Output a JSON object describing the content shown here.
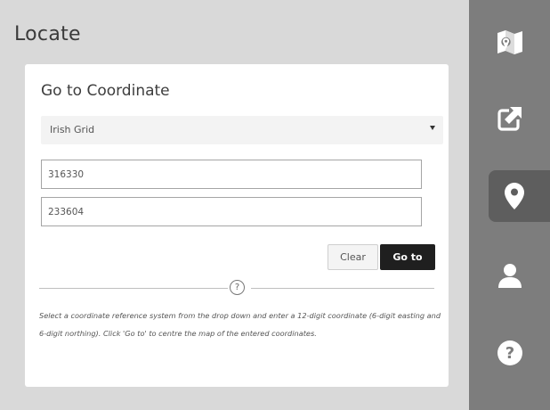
{
  "panel": {
    "title": "Locate"
  },
  "card": {
    "title": "Go to Coordinate",
    "crs_select": {
      "selected": "Irish Grid"
    },
    "easting": {
      "value": "316330"
    },
    "northing": {
      "value": "233604"
    },
    "buttons": {
      "clear_label": "Clear",
      "goto_label": "Go to"
    },
    "help_glyph": "?",
    "help_text": "Select a coordinate reference system from the drop down and enter a 12-digit coordinate (6-digit easting and 6-digit northing). Click 'Go to' to centre the map of the entered coordinates."
  },
  "rail": {
    "items": [
      {
        "icon": "map-icon",
        "active": false
      },
      {
        "icon": "share-icon",
        "active": false
      },
      {
        "icon": "location-pin-icon",
        "active": true
      },
      {
        "icon": "user-icon",
        "active": false
      },
      {
        "icon": "help-icon",
        "active": false
      }
    ]
  },
  "colors": {
    "rail": "#7d7d7d",
    "rail_active": "#5e5e5e",
    "goto_button": "#1f1f1f",
    "panel_bg": "#d9d9d9"
  }
}
